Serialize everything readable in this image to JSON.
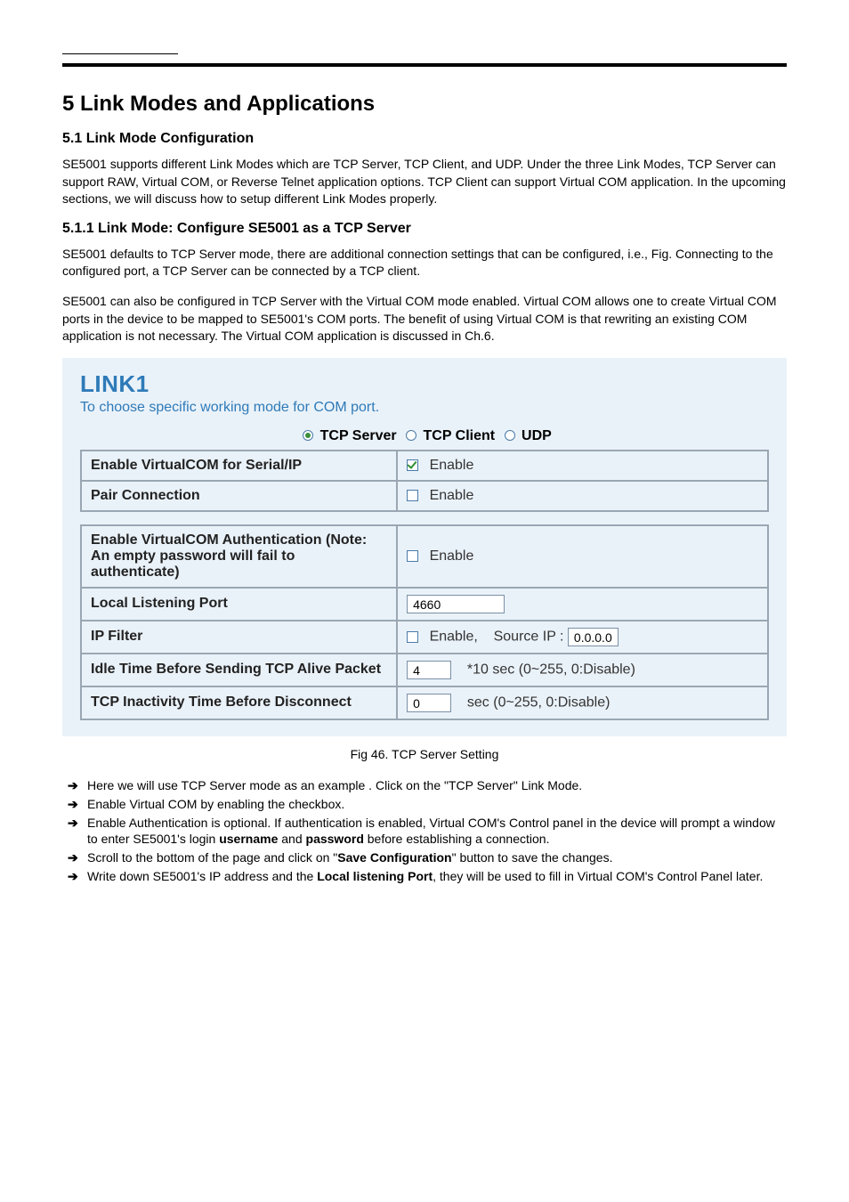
{
  "doc": {
    "main_title": "5 Link Modes and Applications",
    "sub1": "5.1 Link Mode Configuration",
    "intro": "SE5001 supports different Link Modes which are TCP Server, TCP Client, and UDP. Under the three Link Modes, TCP Server can support RAW, Virtual COM, or Reverse Telnet application options. TCP Client can support Virtual COM application. In the upcoming sections, we will discuss how to setup different Link Modes properly.",
    "sub2": "5.1.1 Link Mode: Configure SE5001 as a TCP Server",
    "para2a": "SE5001 defaults to TCP Server mode, there are additional connection settings that can be configured, i.e., Fig. Connecting to the configured port, a TCP Server can be connected by a TCP client.",
    "para2b": "SE5001 can also be configured in TCP Server with the Virtual COM mode enabled. Virtual COM allows one to create Virtual COM ports in the device to be mapped to SE5001's COM ports. The benefit of using Virtual COM is that rewriting an existing COM application is not necessary. The Virtual COM application is discussed in Ch.6."
  },
  "panel": {
    "title": "LINK1",
    "subtitle": "To choose specific working mode for COM port.",
    "modes": {
      "r1": "TCP Server",
      "r2": "TCP Client",
      "r3": "UDP"
    },
    "rows": {
      "vcom_label": "Enable VirtualCOM for Serial/IP",
      "vcom_val": "Enable",
      "pair_label": "Pair Connection",
      "pair_val": "Enable",
      "auth_label": "Enable VirtualCOM Authentication (Note: An empty password will fail to authenticate)",
      "auth_val": "Enable",
      "port_label": "Local Listening Port",
      "port_val": "4660",
      "ipf_label": "IP Filter",
      "ipf_en": "Enable,",
      "ipf_src": "Source IP :",
      "ipf_val": "0.0.0.0",
      "idle_label": "Idle Time Before Sending TCP Alive Packet",
      "idle_val": "4",
      "idle_suffix": "*10 sec (0~255, 0:Disable)",
      "inact_label": "TCP Inactivity Time Before Disconnect",
      "inact_val": "0",
      "inact_suffix": "sec (0~255, 0:Disable)"
    }
  },
  "caption": "Fig 46. TCP Server Setting",
  "steps": {
    "s1": "Here we will use TCP Server mode as an example . Click on the \"TCP Server\" Link Mode.",
    "s2": "Enable Virtual COM by enabling the checkbox.",
    "s3_a": "Enable Authentication is optional. If authentication is enabled, Virtual COM's Control panel in the device will prompt a window to enter SE5001's login ",
    "s3_b": "username",
    "s3_c": " and ",
    "s3_d": "password",
    "s3_e": " before establishing a connection.",
    "s4_a": "Scroll to the bottom of the page and click on \"",
    "s4_b": "Save Configuration",
    "s4_c": "\" button to save the changes.",
    "s5_a": "Write down SE5001's IP address and the ",
    "s5_b": "Local listening Port",
    "s5_c": ", they will be used to fill in Virtual COM's Control Panel later."
  }
}
